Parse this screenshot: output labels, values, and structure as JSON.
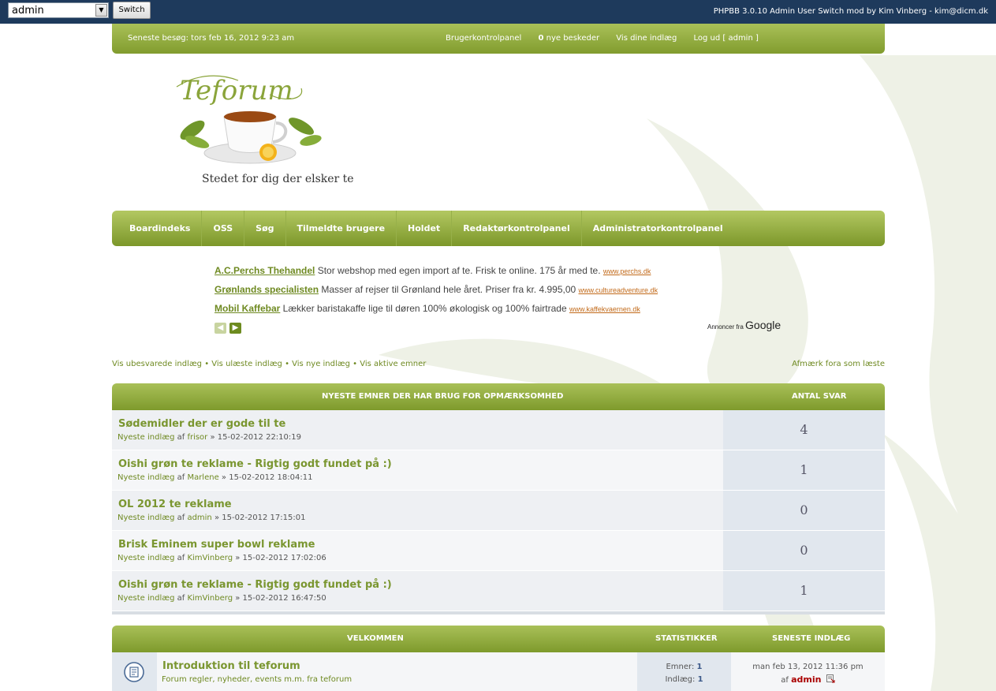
{
  "admin_bar": {
    "selected_user": "admin",
    "switch_label": "Switch",
    "credit": "PHPBB 3.0.10 Admin User Switch mod by Kim Vinberg - kim@dicm.dk"
  },
  "topbar": {
    "last_visit": "Seneste besøg: tors feb 16, 2012 9:23 am",
    "ucp": "Brugerkontrolpanel",
    "pm_count": "0",
    "pm_label": " nye beskeder",
    "own_posts": "Vis dine indlæg",
    "logout": "Log ud [ admin ]"
  },
  "logo": {
    "text": "Teforum",
    "slogan": "Stedet for dig der elsker te"
  },
  "nav": [
    "Boardindeks",
    "OSS",
    "Søg",
    "Tilmeldte brugere",
    "Holdet",
    "Redaktørkontrolpanel",
    "Administratorkontrolpanel"
  ],
  "ads": [
    {
      "title": "A.C.Perchs Thehandel",
      "text": " Stor webshop med egen import af te. Frisk te online. 175 år med te. ",
      "url": "www.perchs.dk"
    },
    {
      "title": "Grønlands specialisten",
      "text": " Masser af rejser til Grønland hele året. Priser fra kr. 4.995,00 ",
      "url": "www.cultureadventure.dk"
    },
    {
      "title": "Mobil Kaffebar",
      "text": " Lækker baristakaffe lige til døren 100% økologisk og 100% fairtrade ",
      "url": "www.kaffekvaernen.dk"
    }
  ],
  "ads_credit": {
    "prefix": "Annoncer fra",
    "brand": "Google"
  },
  "quicklinks": {
    "unanswered": "Vis ubesvarede indlæg",
    "unread": "Vis ulæste indlæg",
    "new": "Vis nye indlæg",
    "active": "Vis aktive emner",
    "mark_read": "Afmærk fora som læste",
    "sep": " • "
  },
  "topics": {
    "header_title": "NYESTE EMNER DER HAR BRUG FOR OPMÆRKSOMHED",
    "header_count": "ANTAL SVAR",
    "meta_prefix": "Nyeste indlæg",
    "meta_by": " af ",
    "meta_arrow": " » ",
    "rows": [
      {
        "title": "Sødemidler der er gode til te",
        "author": "frisor",
        "date": "15-02-2012 22:10:19",
        "replies": "4"
      },
      {
        "title": "Oishi grøn te reklame - Rigtig godt fundet på :)",
        "author": "Marlene",
        "date": "15-02-2012 18:04:11",
        "replies": "1"
      },
      {
        "title": "OL 2012 te reklame",
        "author": "admin",
        "date": "15-02-2012 17:15:01",
        "replies": "0"
      },
      {
        "title": "Brisk Eminem super bowl reklame",
        "author": "KimVinberg",
        "date": "15-02-2012 17:02:06",
        "replies": "0"
      },
      {
        "title": "Oishi grøn te reklame - Rigtig godt fundet på :)",
        "author": "KimVinberg",
        "date": "15-02-2012 16:47:50",
        "replies": "1"
      }
    ]
  },
  "forums": {
    "header_title": "VELKOMMEN",
    "header_stats": "STATISTIKKER",
    "header_last": "SENESTE INDLÆG",
    "row": {
      "title": "Introduktion til teforum",
      "desc": "Forum regler, nyheder, events m.m. fra teforum",
      "topics_label": "Emner: ",
      "topics": "1",
      "posts_label": "Indlæg: ",
      "posts": "1",
      "last_date": "man feb 13, 2012 11:36 pm",
      "last_by": "af ",
      "last_author": "admin"
    }
  }
}
